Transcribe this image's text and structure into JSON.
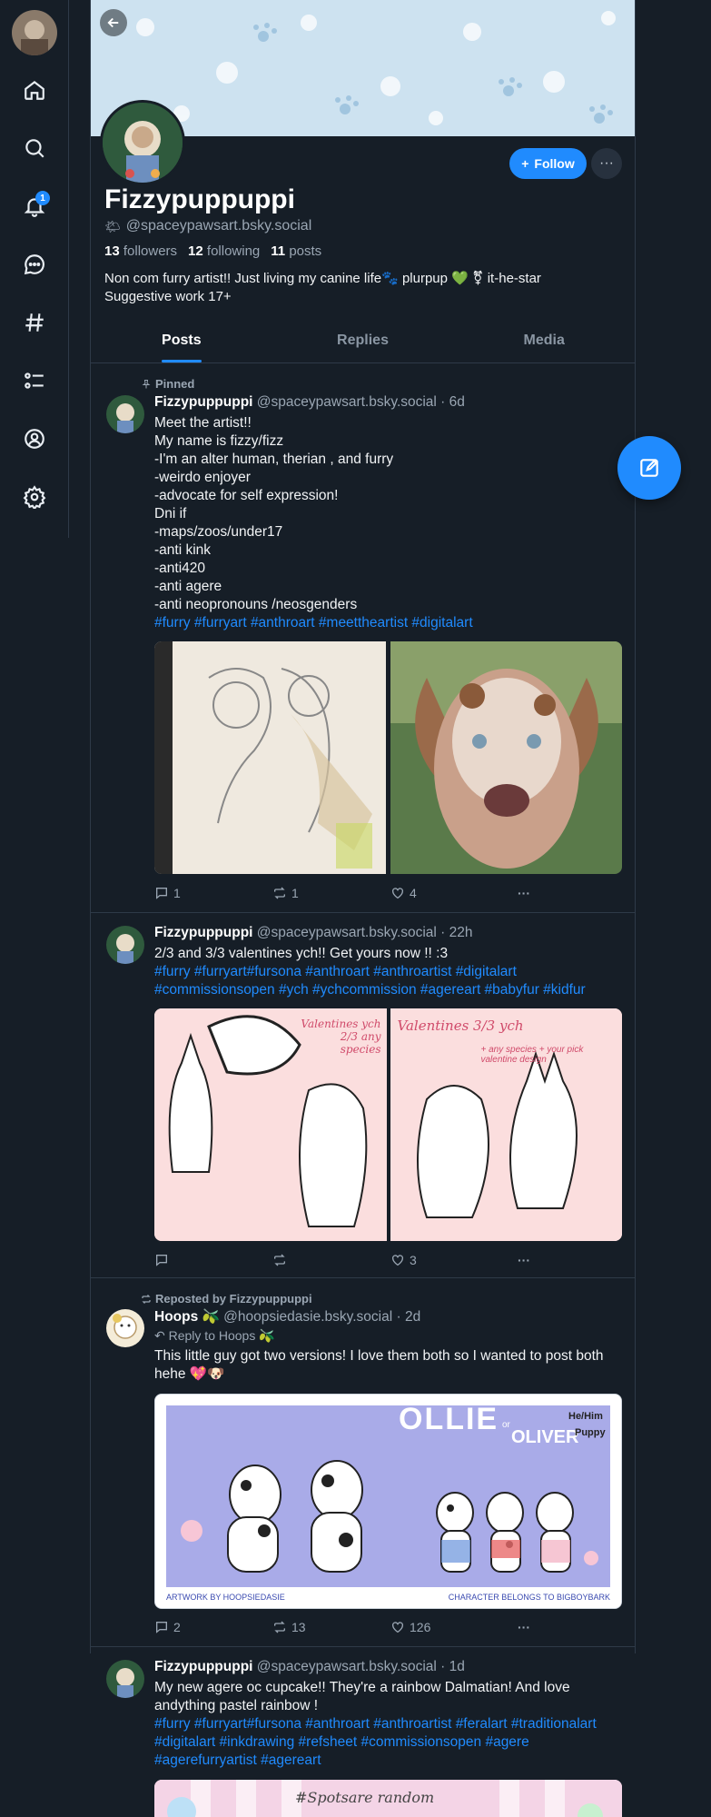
{
  "nav": {
    "notification_count": "1"
  },
  "profile": {
    "display_name": "Fizzypuppuppi",
    "handle": "@spaceypawsart.bsky.social",
    "followers_count": "13",
    "followers_label": "followers",
    "following_count": "12",
    "following_label": "following",
    "posts_count": "11",
    "posts_label": "posts",
    "bio_line1": "Non com furry artist!! Just living my canine life🐾 plurpup 💚 ⚧ it-he-star",
    "bio_line2": "Suggestive work 17+",
    "follow_label": "Follow"
  },
  "tabs": [
    {
      "label": "Posts",
      "active": true
    },
    {
      "label": "Replies",
      "active": false
    },
    {
      "label": "Media",
      "active": false
    }
  ],
  "posts": [
    {
      "context": "Pinned",
      "author": "Fizzypuppuppi",
      "handle": "@spaceypawsart.bsky.social · 6d",
      "lines": [
        "Meet the artist!!",
        "My name is fizzy/fizz",
        "-I'm an alter human, therian , and furry",
        "-weirdo enjoyer",
        "-advocate for self expression!",
        "Dni if",
        "-maps/zoos/under17",
        "-anti kink",
        "-anti420",
        "-anti agere",
        "-anti neopronouns /neosgenders"
      ],
      "tags": "#furry #furryart #anthroart #meettheartist #digitalart",
      "replies": "1",
      "reposts": "1",
      "likes": "4"
    },
    {
      "author": "Fizzypuppuppi",
      "handle": "@spaceypawsart.bsky.social · 22h",
      "text": "2/3 and 3/3 valentines ych!! Get yours now !! :3",
      "tags_line1": "#furry #furryart#fursona #anthroart #anthroartist #digitalart",
      "tags_line2": "#commissionsopen #ych #ychcommission #agereart #babyfur #kidfur",
      "img1_text": "Valentines ych 2/3 any species",
      "img2_text": "Valentines 3/3 ych",
      "img2_sub": "+ any species + your pick valentine design",
      "replies": "",
      "reposts": "",
      "likes": "3"
    },
    {
      "context": "Reposted by Fizzypuppuppi",
      "author": "Hoops 🫒",
      "handle": "@hoopsiedasie.bsky.social · 2d",
      "reply_to": "Reply to Hoops 🫒",
      "text_line1": "This little guy got two versions! I love them both so I wanted to post both",
      "text_line2": "hehe 💖🐶",
      "img_title": "OLLIE",
      "img_or": "or",
      "img_subtitle": "OLIVER",
      "img_pronoun": "He/Him",
      "img_type": "Puppy",
      "img_credit_left": "Artwork by HoopsieDasie",
      "img_credit_right": "Character belongs to BigBoyBark",
      "replies": "2",
      "reposts": "13",
      "likes": "126"
    },
    {
      "author": "Fizzypuppuppi",
      "handle": "@spaceypawsart.bsky.social · 1d",
      "text_line1": "My new agere oc cupcake!! They're a rainbow Dalmatian! And love",
      "text_line2": "andything pastel rainbow !",
      "tags_line1": "#furry #furryart#fursona #anthroart #anthroartist #feralart #traditionalart",
      "tags_line2": "#digitalart #inkdrawing #refsheet #commissionsopen #agere",
      "tags_line3": "#agerefurryartist #agereart",
      "img_text": "#Spotsare random"
    }
  ],
  "colors": {
    "background": "#161e27",
    "accent": "#208bfe",
    "muted": "#9aa6b3",
    "border": "#2e3a48"
  }
}
